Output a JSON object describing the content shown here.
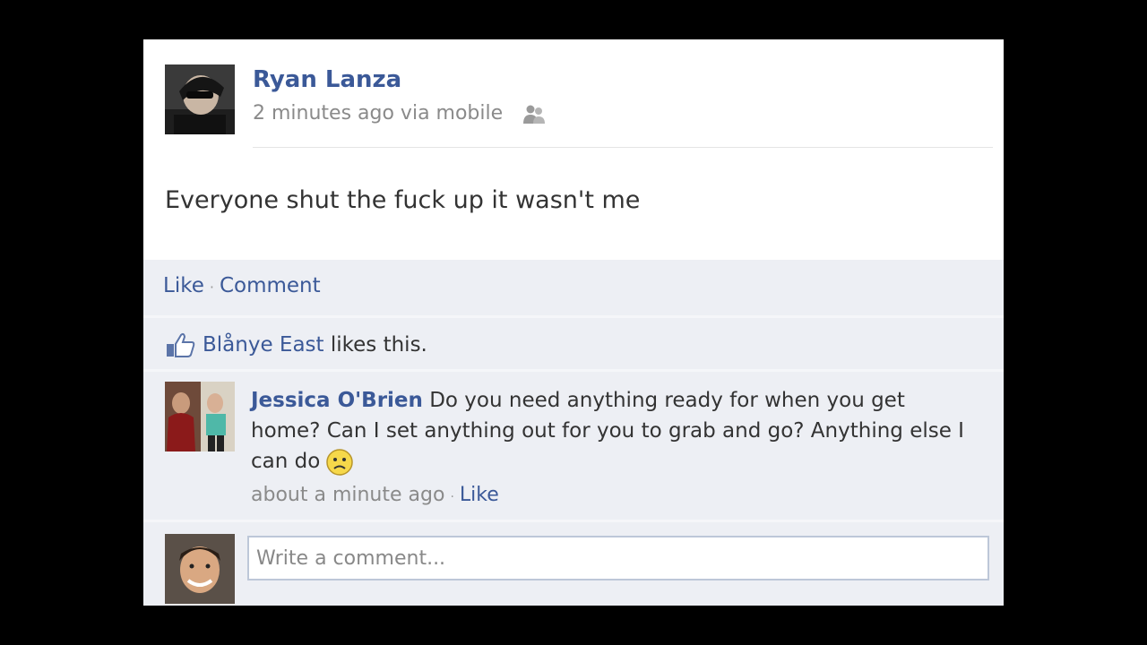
{
  "post": {
    "author": "Ryan Lanza",
    "meta": "2 minutes ago via mobile",
    "privacy_icon": "people-icon",
    "text": "Everyone shut the fuck up it wasn't me"
  },
  "actions": {
    "like": "Like",
    "separator": "·",
    "comment": "Comment"
  },
  "likes": {
    "icon": "thumbs-up-icon",
    "name": "Blånye East",
    "suffix": "likes this."
  },
  "comments": [
    {
      "author": "Jessica O'Brien",
      "text": "Do you need anything ready for when you get home? Can I set anything out for you to grab and go? Anything else I can do",
      "emoticon": "sad-face-icon",
      "time": "about a minute ago",
      "separator": "·",
      "like": "Like"
    }
  ],
  "composer": {
    "placeholder": "Write a comment..."
  },
  "colors": {
    "link": "#3b5998",
    "ufi_background": "#edeff4",
    "page_background": "#000000"
  }
}
